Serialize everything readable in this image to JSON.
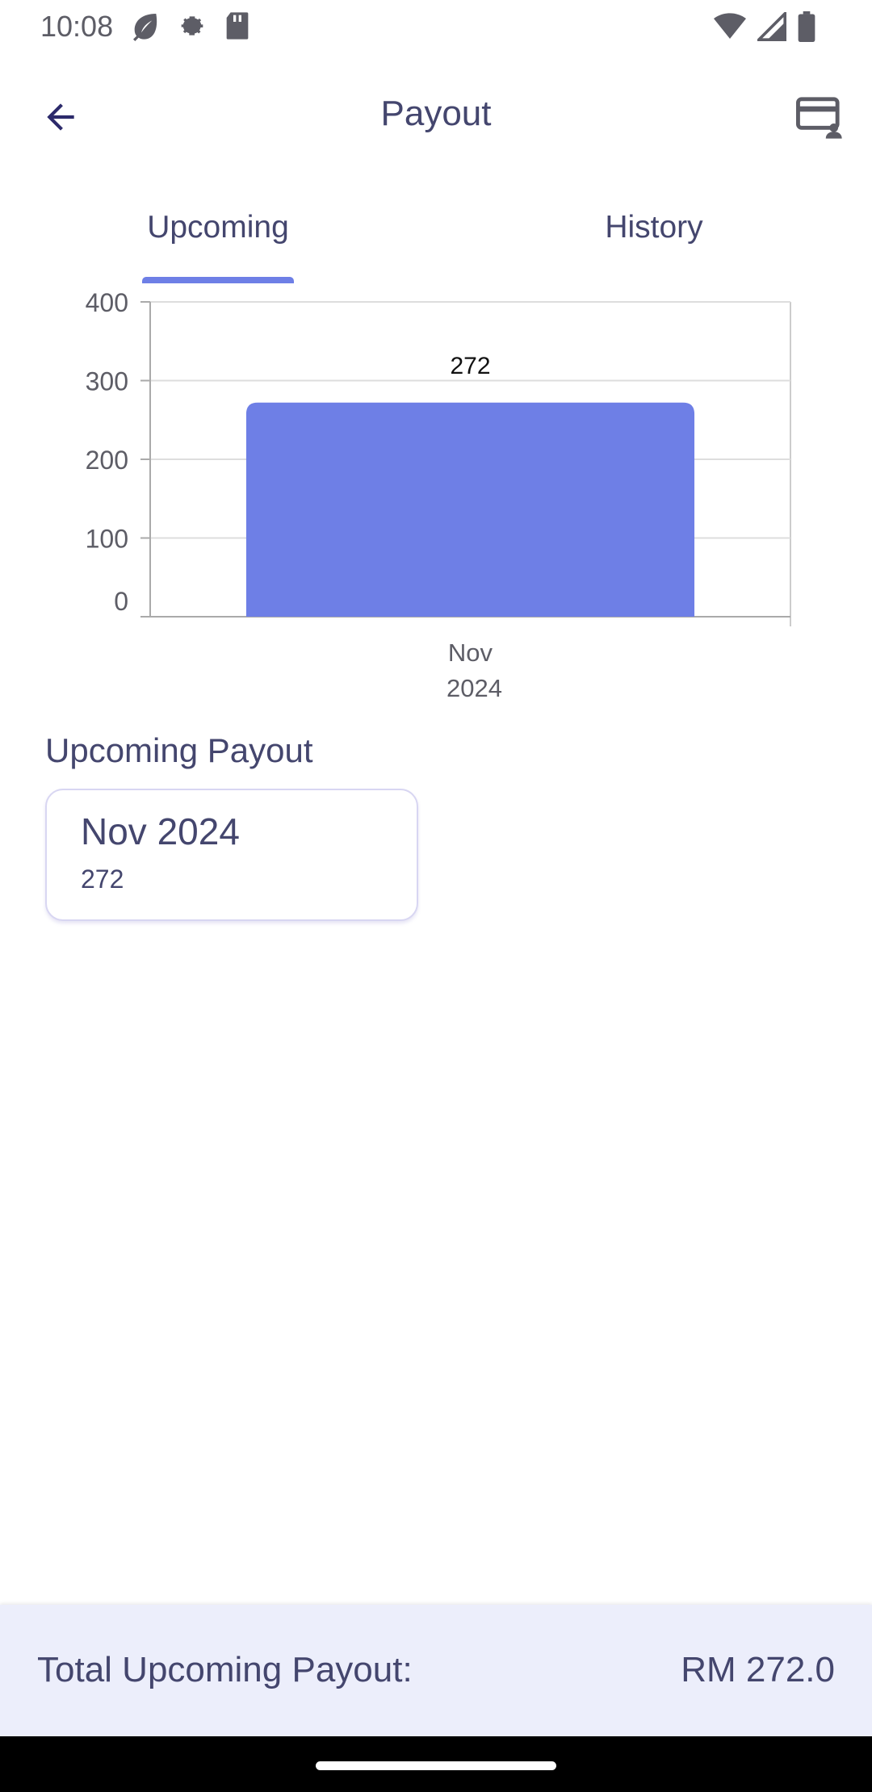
{
  "status_bar": {
    "time": "10:08",
    "left_icons": [
      "leaf-icon",
      "gear-icon",
      "sd-card-icon"
    ],
    "right_icons": [
      "wifi-icon",
      "signal-icon",
      "battery-icon"
    ]
  },
  "app_bar": {
    "title": "Payout",
    "back_icon": "arrow-back-icon",
    "action_icon": "card-account-icon"
  },
  "tabs": [
    {
      "label": "Upcoming",
      "selected": true
    },
    {
      "label": "History",
      "selected": false
    }
  ],
  "chart_data": {
    "type": "bar",
    "categories": [
      "Nov\n2024"
    ],
    "values": [
      272
    ],
    "data_labels": [
      "272"
    ],
    "yticks": [
      0,
      100,
      200,
      300,
      400
    ],
    "ylim": [
      0,
      400
    ],
    "grid": true,
    "bar_color": "#6e7fe6"
  },
  "upcoming": {
    "section_title": "Upcoming Payout",
    "items": [
      {
        "month": "Nov 2024",
        "amount": "272"
      }
    ]
  },
  "footer": {
    "label": "Total Upcoming Payout:",
    "value": "RM 272.0"
  },
  "colors": {
    "accent": "#6e7fe6",
    "text": "#44466e",
    "footer_bg": "#eceefb"
  }
}
